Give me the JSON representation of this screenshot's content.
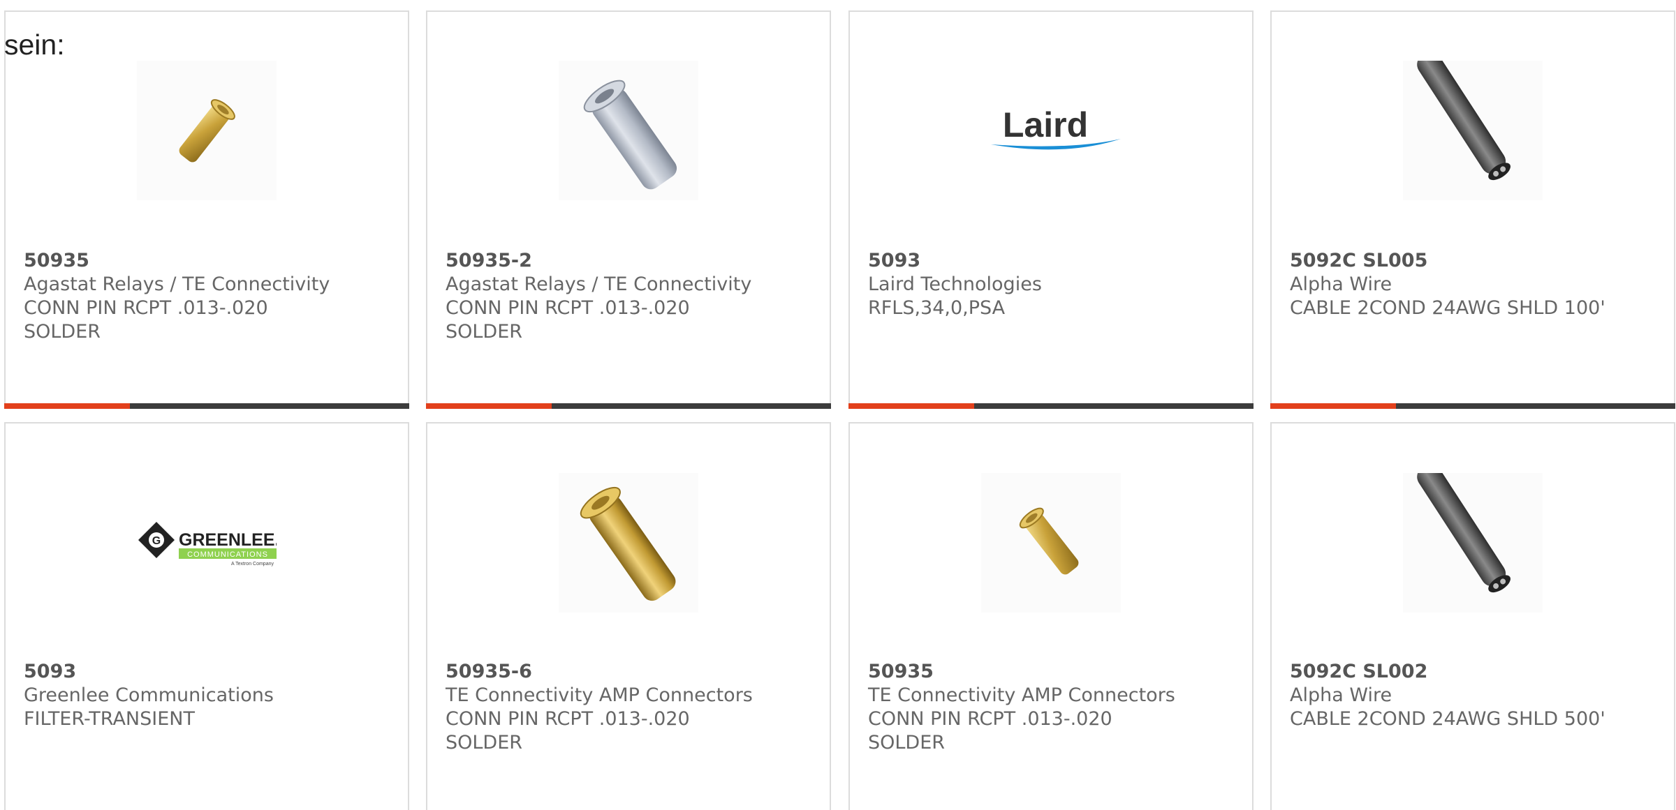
{
  "intro_text": "sein:",
  "accent_color": "#e2401c",
  "bar_track_color": "#3c3c3c",
  "progress_fraction": 0.31,
  "products": [
    {
      "part_number": "50935",
      "manufacturer": "Agastat Relays / TE Connectivity",
      "description": "CONN PIN RCPT .013-.020\nSOLDER",
      "image_icon": "gold-pin-small-icon"
    },
    {
      "part_number": "50935-2",
      "manufacturer": "Agastat Relays / TE Connectivity",
      "description": "CONN PIN RCPT .013-.020\nSOLDER",
      "image_icon": "silver-pin-icon"
    },
    {
      "part_number": "5093",
      "manufacturer": "Laird Technologies",
      "description": "RFLS,34,0,PSA",
      "image_icon": "laird-logo",
      "logo_text": "Laird"
    },
    {
      "part_number": "5092C SL005",
      "manufacturer": "Alpha Wire",
      "description": "CABLE 2COND 24AWG SHLD 100'",
      "image_icon": "cable-icon"
    },
    {
      "part_number": "5093",
      "manufacturer": "Greenlee Communications",
      "description": "FILTER-TRANSIENT",
      "image_icon": "greenlee-logo",
      "logo_text": "GREENLEE.",
      "logo_subtext": "COMMUNICATIONS",
      "logo_tagline": "A Textron Company"
    },
    {
      "part_number": "50935-6",
      "manufacturer": "TE Connectivity AMP Connectors",
      "description": "CONN PIN RCPT .013-.020\nSOLDER",
      "image_icon": "gold-pin-large-icon"
    },
    {
      "part_number": "50935",
      "manufacturer": "TE Connectivity AMP Connectors",
      "description": "CONN PIN RCPT .013-.020\nSOLDER",
      "image_icon": "gold-pin-small-icon"
    },
    {
      "part_number": "5092C SL002",
      "manufacturer": "Alpha Wire",
      "description": "CABLE 2COND 24AWG SHLD 500'",
      "image_icon": "cable-icon"
    }
  ]
}
